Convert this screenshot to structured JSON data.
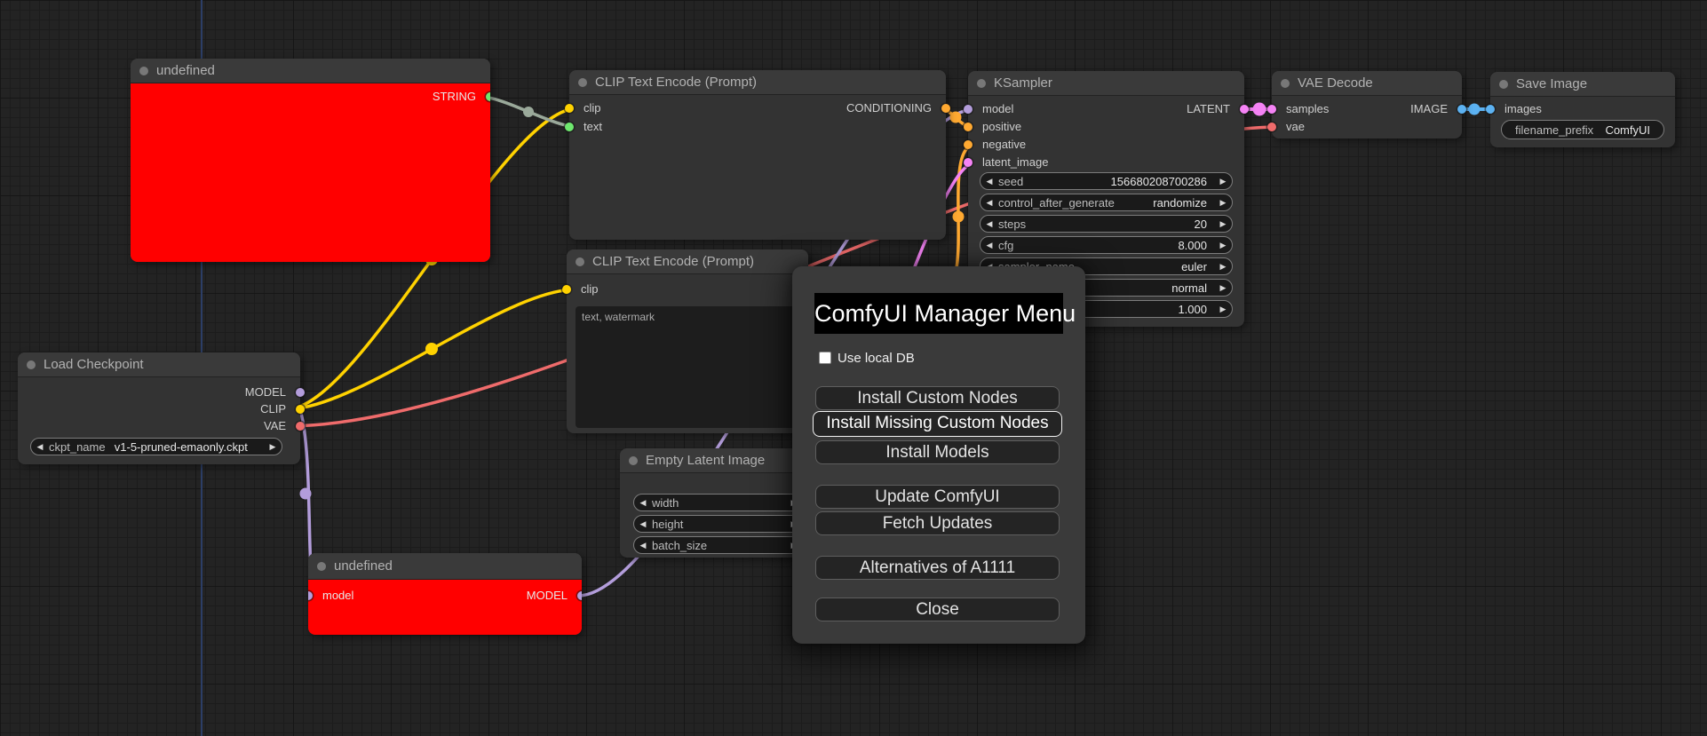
{
  "link_colors": {
    "model": "#b39ddb",
    "clip": "#ffd200",
    "vae": "#ef6b6b",
    "conditioning": "#ffa931",
    "latent": "#f583f5",
    "image": "#5cb2f2",
    "string": "#9aa99a"
  },
  "node_colors": {
    "error_body": "#ff0000",
    "body": "#333333",
    "title": "#3a3a3a"
  },
  "nodes": {
    "undefined_top": {
      "title": "undefined",
      "output_label": "STRING"
    },
    "clip_encode_1": {
      "title": "CLIP Text Encode (Prompt)",
      "inputs": [
        "clip",
        "text"
      ],
      "output_label": "CONDITIONING"
    },
    "clip_encode_2": {
      "title": "CLIP Text Encode (Prompt)",
      "inputs": [
        "clip"
      ],
      "text_value": "text, watermark"
    },
    "ksampler": {
      "title": "KSampler",
      "inputs": [
        "model",
        "positive",
        "negative",
        "latent_image"
      ],
      "output_label": "LATENT",
      "widgets": [
        {
          "label": "seed",
          "value": "156680208700286"
        },
        {
          "label": "control_after_generate",
          "value": "randomize"
        },
        {
          "label": "steps",
          "value": "20"
        },
        {
          "label": "cfg",
          "value": "8.000"
        },
        {
          "label": "sampler_name",
          "value": "euler"
        },
        {
          "label": "",
          "value": "normal"
        },
        {
          "label": "",
          "value": "1.000"
        }
      ]
    },
    "vae_decode": {
      "title": "VAE Decode",
      "inputs": [
        "samples",
        "vae"
      ],
      "output_label": "IMAGE"
    },
    "save_image": {
      "title": "Save Image",
      "inputs": [
        "images"
      ],
      "widget": {
        "label": "filename_prefix",
        "value": "ComfyUI"
      }
    },
    "load_checkpoint": {
      "title": "Load Checkpoint",
      "outputs": [
        "MODEL",
        "CLIP",
        "VAE"
      ],
      "widget": {
        "label": "ckpt_name",
        "value": "v1-5-pruned-emaonly.ckpt"
      }
    },
    "empty_latent": {
      "title": "Empty Latent Image",
      "widgets": [
        {
          "label": "width",
          "value": ""
        },
        {
          "label": "height",
          "value": ""
        },
        {
          "label": "batch_size",
          "value": ""
        }
      ]
    },
    "undefined_bottom": {
      "title": "undefined",
      "input_label": "model",
      "output_label": "MODEL"
    }
  },
  "dialog": {
    "title": "ComfyUI Manager Menu",
    "checkbox_label": "Use local DB",
    "buttons": [
      "Install Custom Nodes",
      "Install Missing Custom Nodes",
      "Install Models",
      "Update ComfyUI",
      "Fetch Updates",
      "Alternatives of A1111",
      "Close"
    ]
  }
}
